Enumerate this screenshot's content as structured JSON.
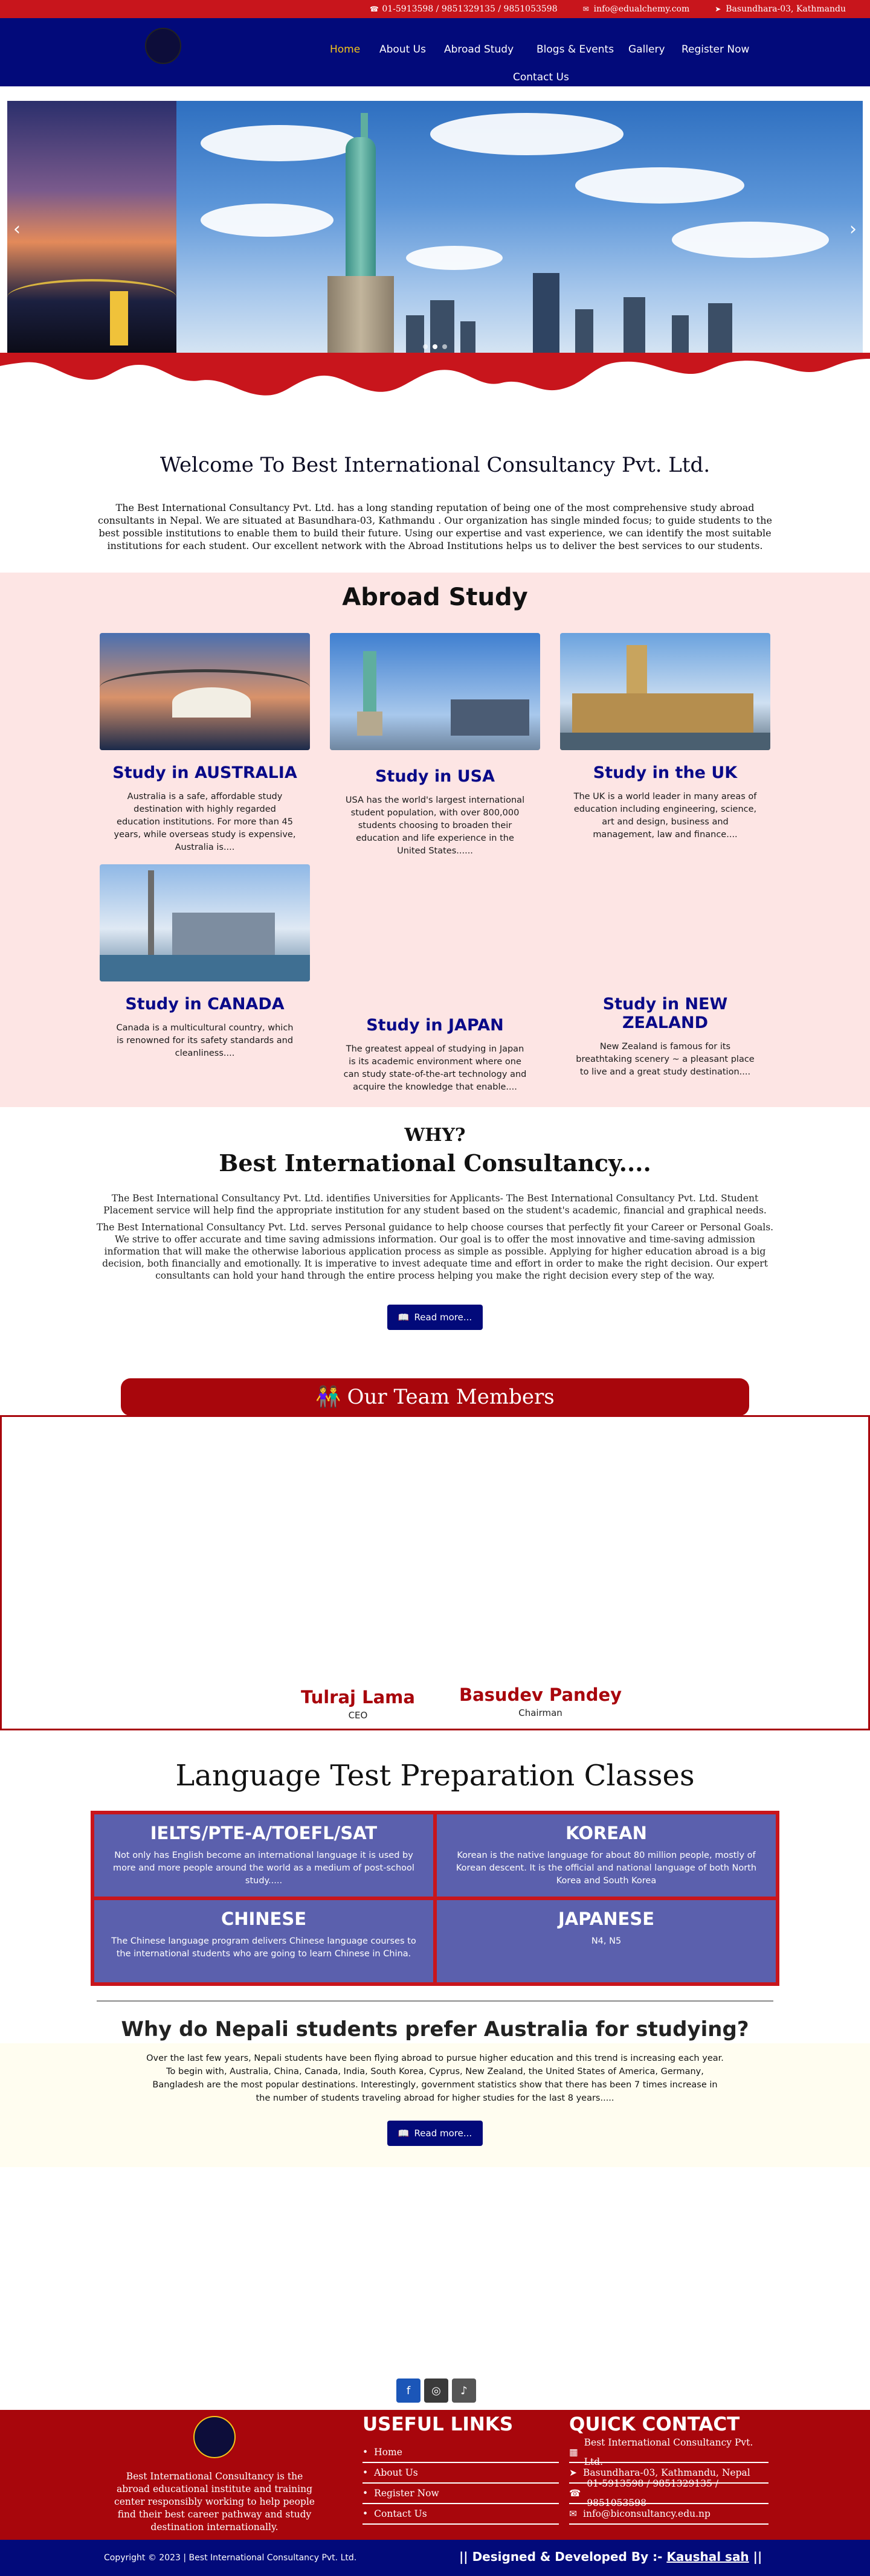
{
  "topbar": {
    "phone": "01-5913598 / 9851329135 / 9851053598",
    "email": "info@edualchemy.com",
    "address": "Basundhara-03, Kathmandu"
  },
  "nav": {
    "items": [
      "Home",
      "About Us",
      "Abroad Study",
      "Blogs & Events",
      "Gallery",
      "Register Now",
      "Contact Us"
    ]
  },
  "slider": {
    "prev": "‹",
    "next": "›"
  },
  "welcome": {
    "title": "Welcome To Best International Consultancy Pvt. Ltd.",
    "body": "The Best International Consultancy Pvt. Ltd. has a long standing reputation of being one of the most comprehensive study abroad consultants in Nepal. We are situated at Basundhara-03, Kathmandu . Our organization has single minded focus; to guide students to the best possible institutions to enable them to build their future. Using our expertise and vast experience, we can identify the most suitable institutions for each student. Our excellent network with the Abroad Institutions helps us to deliver the best services to our students."
  },
  "abroad": {
    "title": "Abroad Study",
    "cards": [
      {
        "title": "Study in AUSTRALIA",
        "text": "Australia is a safe, affordable study destination with highly regarded education institutions. For more than 45 years, while overseas study is expensive, Australia is...."
      },
      {
        "title": "Study in USA",
        "text": "USA has the world's largest international student population, with over 800,000 students choosing to broaden their education and life experience in the United States......"
      },
      {
        "title": "Study in the UK",
        "text": "The UK is a world leader in many areas of education including engineering, science, art and design, business and management, law and finance...."
      },
      {
        "title": "Study in CANADA",
        "text": "Canada is a multicultural country, which is renowned for its safety standards and cleanliness...."
      },
      {
        "title": "Study in JAPAN",
        "text": "The greatest appeal of studying in Japan is its academic environment where one can study state-of-the-art technology and acquire the knowledge that enable...."
      },
      {
        "title": "Study in NEW ZEALAND",
        "text": "New Zealand is famous for its breathtaking scenery ~ a pleasant place to live and a great study destination...."
      }
    ]
  },
  "why": {
    "kicker": "WHY?",
    "title": "Best International Consultancy....",
    "p1": "The Best International Consultancy Pvt. Ltd. identifies Universities for Applicants- The Best International Consultancy Pvt. Ltd. Student Placement service will help find the appropriate institution for any student based on the student's academic, financial and graphical needs.",
    "p2": "The Best International Consultancy Pvt. Ltd. serves Personal guidance to help choose courses that perfectly fit your Career or Personal Goals. We strive to offer accurate and time saving admissions information. Our goal is to offer the most innovative and time-saving admission information that will make the otherwise laborious application process as simple as possible. Applying for higher education abroad is a big decision, both financially and emotionally. It is imperative to invest adequate time and effort in order to make the right decision. Our expert consultants can hold your hand through the entire process helping you make the right decision every step of the way.",
    "button": "Read more..."
  },
  "team": {
    "title": "Our Team Members",
    "members": [
      {
        "name": "Tulraj Lama",
        "role": "CEO"
      },
      {
        "name": "Basudev Pandey",
        "role": "Chairman"
      }
    ]
  },
  "language": {
    "title": "Language Test Preparation Classes",
    "cells": [
      {
        "title": "IELTS/PTE-A/TOEFL/SAT",
        "text": "Not only has English become an international language it is used by more and more people around the world as a medium of post-school study....."
      },
      {
        "title": "KOREAN",
        "text": "Korean is the native language for about 80 million people, mostly of Korean descent. It is the official and national language of both North Korea and South Korea"
      },
      {
        "title": "CHINESE",
        "text": "The Chinese language program delivers Chinese language courses to the international students who are going to learn Chinese in China."
      },
      {
        "title": "JAPANESE",
        "text": "N4, N5"
      }
    ]
  },
  "australia": {
    "title": "Why do Nepali students prefer Australia for studying?",
    "text": "Over the last few years, Nepali students have been flying abroad to pursue higher education and this trend is increasing each year. To begin with, Australia, China, Canada, India, South Korea, Cyprus, New Zealand, the United States of America, Germany, Bangladesh are the most popular destinations. Interestingly, government statistics show that there has been 7 times increase in the number of students traveling abroad for higher studies for the last 8 years.....",
    "button": "Read more..."
  },
  "footer": {
    "about": "Best International Consultancy is the abroad educational institute and training center responsibly working to help people find their best career pathway and study destination internationally.",
    "links_title": "USEFUL LINKS",
    "links": [
      "Home",
      "About Us",
      "Register Now",
      "Contact Us"
    ],
    "contact_title": "QUICK CONTACT",
    "contacts": [
      "Best International Consultancy Pvt. Ltd.",
      "Basundhara-03, Kathmandu, Nepal",
      "01-5913598 / 9851329135 / 9851053598",
      "info@biconsultancy.edu.np"
    ],
    "copyright": "Copyright © 2023    | Best International Consultancy Pvt. Ltd.",
    "credit_prefix": "|| Designed & Developed By :- ",
    "credit_name": "Kaushal sah",
    "credit_suffix": " ||"
  },
  "colors": {
    "red": "#c8151c",
    "navy": "#020a7a",
    "dark_red": "#a8060c",
    "lang_cell": "#5b60ad"
  }
}
